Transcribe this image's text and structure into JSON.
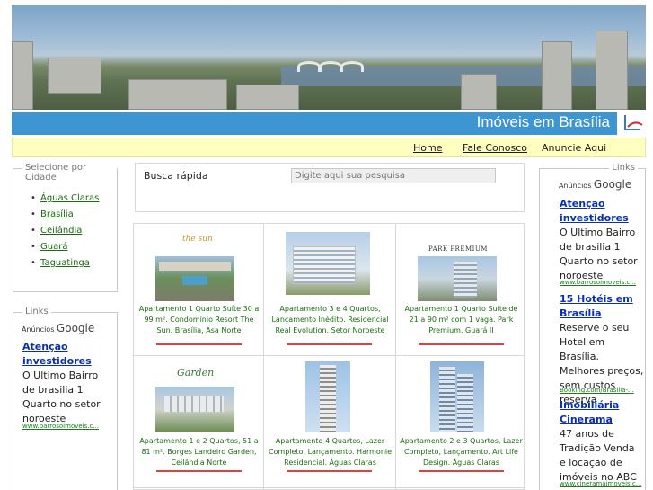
{
  "header": {
    "site_title": "Imóveis em Brasília"
  },
  "nav": {
    "items": [
      "Home",
      "Fale Conosco",
      "Anuncie Aqui"
    ]
  },
  "sidebar_left": {
    "legend": "Selecione por Cidade",
    "cities": [
      "Águas Claras",
      "Brasília",
      "Ceilândia",
      "Guará",
      "Taguatinga"
    ]
  },
  "links_left": {
    "legend": "Links",
    "ads_label": "Anúncios",
    "ads_brand": "Google",
    "ads": [
      {
        "title": "Atençao investidores",
        "text": "O Ultimo Bairro de brasilia 1 Quarto no setor noroeste",
        "url": "www.barrosoimoveis.c..."
      }
    ]
  },
  "search": {
    "label": "Busca rápida",
    "placeholder": "Digite aqui sua pesquisa"
  },
  "listings": [
    {
      "brand": "the sun",
      "text": "Apartamento 1 Quarto Suíte 30 a 99 m². Condomínio Resort The Sun. Brasília, Asa Norte"
    },
    {
      "brand": "",
      "text": "Apartamento 3 e 4 Quartos, Lançamento Inédito. Residencial Real Evolution. Setor Noroeste"
    },
    {
      "brand": "PARK PREMIUM",
      "text": "Apartamento 1 Quarto Suíte de 21 a 90 m² com 1 vaga. Park Premium. Guará II"
    },
    {
      "brand": "Garden",
      "text": "Apartamento 1 e 2 Quartos, 51 a 81 m². Borges Landeiro Garden, Ceilândia Norte"
    },
    {
      "brand": "",
      "text": "Apartamento 4 Quartos, Lazer Completo, Lançamento. Harmonie Residencial. Águas Claras"
    },
    {
      "brand": "",
      "text": "Apartamento 2 e 3 Quartos, Lazer Completo, Lançamento. Art Life Design. Águas Claras"
    }
  ],
  "links_right": {
    "legend": "Links",
    "ads_label": "Anúncios",
    "ads_brand": "Google",
    "ads": [
      {
        "title": "Atençao investidores",
        "text": "O Ultimo Bairro de brasilia 1 Quarto no setor noroeste",
        "url": "www.barrosoimoveis.c..."
      },
      {
        "title": "15 Hotéis em Brasília",
        "text": "Reserve o seu Hotel em Brasília. Melhores preços, sem custos reserva",
        "url": "Booking.com/Brasilia-..."
      },
      {
        "title": "Imobiliária Cinerama",
        "text": "47 anos de Tradição Venda e locação de imóveis no ABC",
        "url": "www.cineramaimoveis.c..."
      }
    ]
  }
}
